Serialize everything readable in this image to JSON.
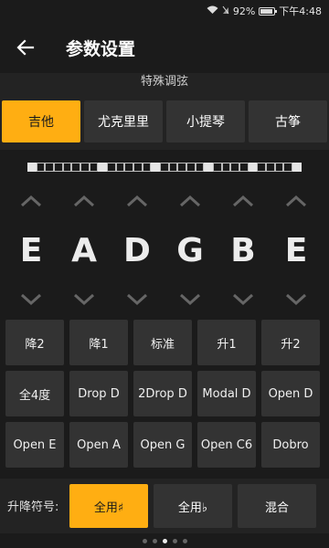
{
  "status": {
    "battery": "92%",
    "battery_level": 0.92,
    "time": "下午4:48"
  },
  "header": {
    "title": "参数设置"
  },
  "tuning": {
    "section_title": "特殊调弦",
    "instruments": [
      "吉他",
      "尤克里里",
      "小提琴",
      "古筝"
    ],
    "selected_instrument": "吉他",
    "strip_cells": [
      1,
      0,
      0,
      0,
      0,
      0,
      0,
      0,
      1,
      0,
      0,
      0,
      0,
      0,
      1,
      0,
      0,
      0,
      0,
      0,
      1,
      0,
      0,
      0,
      0,
      1,
      0,
      0,
      0,
      0,
      1
    ],
    "strings": [
      "E",
      "A",
      "D",
      "G",
      "B",
      "E"
    ],
    "buttons": [
      [
        "降2",
        "降1",
        "标准",
        "升1",
        "升2"
      ],
      [
        "全4度",
        "Drop D",
        "2Drop D",
        "Modal D",
        "Open D"
      ],
      [
        "Open E",
        "Open A",
        "Open G",
        "Open C6",
        "Dobro"
      ]
    ]
  },
  "symbols": {
    "label": "升降符号:",
    "options": [
      "全用♯",
      "全用♭",
      "混合"
    ],
    "selected": "全用♯"
  },
  "pager": {
    "count": 5,
    "active_index": 2
  },
  "colors": {
    "accent": "#ffae12",
    "background": "#1b1b1b",
    "button": "#333333"
  }
}
